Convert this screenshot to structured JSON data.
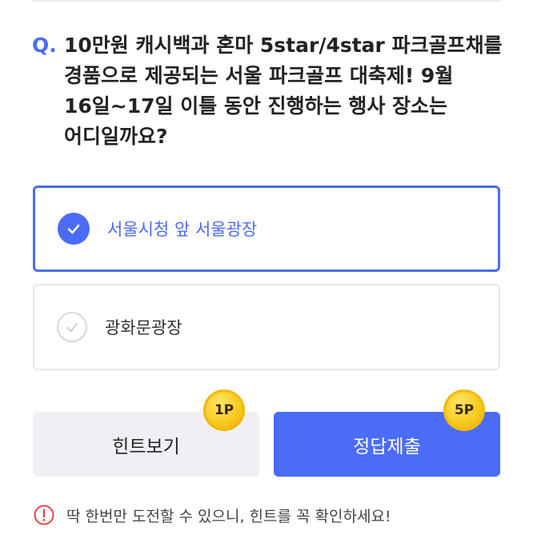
{
  "question": {
    "prefix": "Q.",
    "text": "10만원 캐시백과 혼마 5star/4star 파크골프채를 경품으로 제공되는 서울 파크골프 대축제! 9월 16일~17일 이틀 동안 진행하는 행사 장소는 어디일까요?"
  },
  "options": [
    {
      "label": "서울시청 앞 서울광장",
      "selected": true
    },
    {
      "label": "광화문광장",
      "selected": false
    }
  ],
  "buttons": {
    "hint_label": "힌트보기",
    "hint_cost": "1P",
    "submit_label": "정답제출",
    "submit_reward": "5P"
  },
  "notice": {
    "text": "딱 한번만 도전할 수 있으니, 힌트를 꼭 확인하세요!"
  },
  "colors": {
    "accent": "#4a6cf7",
    "hint_bg": "#eef0f4",
    "warning": "#e5484d",
    "coin": "#f7c81c"
  },
  "icons": {
    "selected_check": "check-circle-filled-icon",
    "unselected_check": "check-circle-outline-icon",
    "notice": "exclamation-circle-icon"
  }
}
